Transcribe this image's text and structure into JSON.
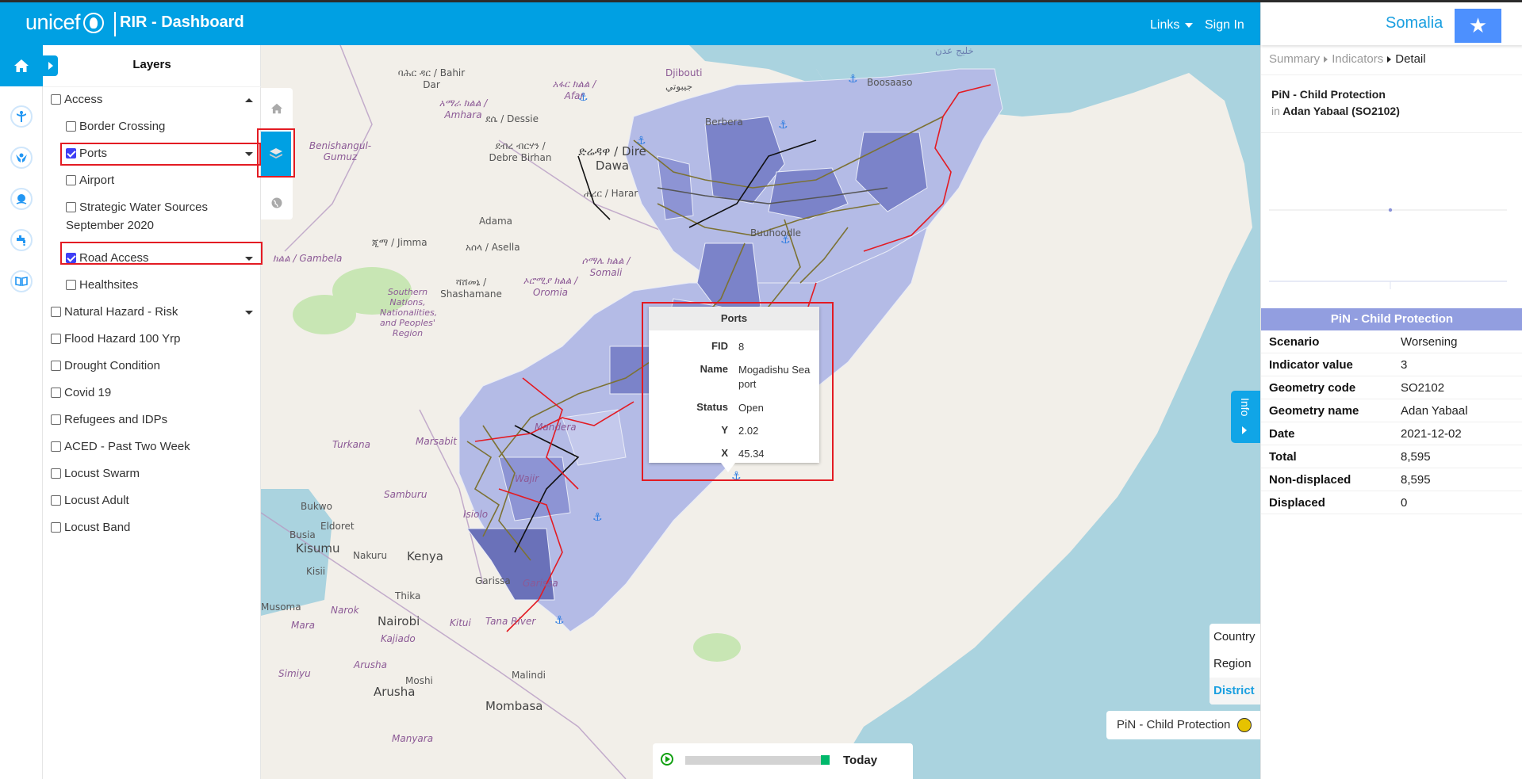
{
  "header": {
    "logo_text": "unicef",
    "app_title": "RIR - Dashboard",
    "links_label": "Links",
    "signin_label": "Sign In",
    "brand_color": "#00a0e3"
  },
  "iconbar": {
    "items": [
      {
        "name": "home",
        "icon": "home-icon"
      },
      {
        "name": "health",
        "icon": "health-icon"
      },
      {
        "name": "protection",
        "icon": "child-protection-icon"
      },
      {
        "name": "nutrition",
        "icon": "nutrition-icon"
      },
      {
        "name": "wash",
        "icon": "water-tap-icon"
      },
      {
        "name": "education",
        "icon": "book-icon"
      }
    ]
  },
  "layers_panel": {
    "title": "Layers",
    "items": [
      {
        "label": "Access",
        "checked": false,
        "level": 0,
        "expander": "up"
      },
      {
        "label": "Border Crossing",
        "checked": false,
        "level": 1
      },
      {
        "label": "Ports",
        "checked": true,
        "level": 1,
        "expander": "down",
        "highlighted": true
      },
      {
        "label": "Airport",
        "checked": false,
        "level": 1
      },
      {
        "label": "Strategic Water Sources",
        "label2": "September 2020",
        "checked": false,
        "level": 1
      },
      {
        "label": "Road Access",
        "checked": true,
        "level": 1,
        "expander": "down",
        "highlighted": true
      },
      {
        "label": "Healthsites",
        "checked": false,
        "level": 1
      },
      {
        "label": "Natural Hazard - Risk",
        "checked": false,
        "level": 0,
        "expander": "down"
      },
      {
        "label": "Flood Hazard 100 Yrp",
        "checked": false,
        "level": 0
      },
      {
        "label": "Drought Condition",
        "checked": false,
        "level": 0
      },
      {
        "label": "Covid 19",
        "checked": false,
        "level": 0
      },
      {
        "label": "Refugees and IDPs",
        "checked": false,
        "level": 0
      },
      {
        "label": "ACED - Past Two Week",
        "checked": false,
        "level": 0
      },
      {
        "label": "Locust Swarm",
        "checked": false,
        "level": 0
      },
      {
        "label": "Locust Adult",
        "checked": false,
        "level": 0
      },
      {
        "label": "Locust Band",
        "checked": false,
        "level": 0
      }
    ]
  },
  "map": {
    "controls": [
      {
        "name": "home",
        "icon": "home-icon"
      },
      {
        "name": "layers",
        "icon": "layers-icon",
        "active": true
      },
      {
        "name": "basemap",
        "icon": "globe-icon"
      }
    ],
    "labels": {
      "djibouti": "Djibouti",
      "djibouti_ar": "جيبوتي",
      "gulf_aden": "خليج عدن",
      "bahir_dar": "ባሕር ዳር / Bahir Dar",
      "amhara": "አማራ ክልል / Amhara",
      "afar": "አፋር ክልል / Afar",
      "dessie": "ደሴ / Dessie",
      "debre_birhan": "ደብረ ብርሃን / Debre Birhan",
      "dire_dawa": "ድሬዳዋ / Dire Dawa",
      "harar": "ሐረር / Harar",
      "benishangul": "Benishangul-Gumuz",
      "adama": "Adama",
      "asella": "አሰላ / Asella",
      "jimma": "ጂማ / Jimma",
      "gambela": "ክልል / Gambela",
      "shashamane": "ሻሸመኔ / Shashamane",
      "oromia": "ኦሮሚያ ክልል / Oromia",
      "snnpr": "Southern Nations, Nationalities, and Peoples' Region",
      "somali_region": "ሶማሌ ክልል / Somali",
      "berbera": "Berbera",
      "boosaaso": "Boosaaso",
      "buuhoodle": "Buuhoodle",
      "mandera": "Mandera",
      "turkana": "Turkana",
      "marsabit": "Marsabit",
      "wajir": "Wajir",
      "samburu": "Samburu",
      "isiolo": "Isiolo",
      "bukwo": "Bukwo",
      "eldoret": "Eldoret",
      "busia": "Busia",
      "kisumu": "Kisumu",
      "nakuru": "Nakuru",
      "kenya": "Kenya",
      "kisii": "Kisii",
      "garissa_town": "Garissa",
      "garissa": "Garissa",
      "thika": "Thika",
      "musoma": "Musoma",
      "narok": "Narok",
      "nairobi": "Nairobi",
      "kitui": "Kitui",
      "tana_river": "Tana River",
      "mara": "Mara",
      "kajiado": "Kajiado",
      "arusha_region": "Arusha",
      "simiyu": "Simiyu",
      "moshi": "Moshi",
      "arusha": "Arusha",
      "malindi": "Malindi",
      "mombasa": "Mombasa",
      "manyara": "Manyara"
    },
    "popup": {
      "title": "Ports",
      "fields": [
        {
          "key": "FID",
          "value": "8"
        },
        {
          "key": "Name",
          "value": "Mogadishu Sea port"
        },
        {
          "key": "Status",
          "value": "Open"
        },
        {
          "key": "Y",
          "value": "2.02"
        },
        {
          "key": "X",
          "value": "45.34"
        }
      ]
    },
    "info_tab_label": "Info",
    "admin_levels": {
      "options": [
        "Country",
        "Region",
        "District"
      ],
      "selected": "District"
    },
    "legend": {
      "label": "PiN - Child Protection",
      "color": "#e6c200"
    },
    "timeline": {
      "label": "Today",
      "progress": 1.0
    }
  },
  "right_panel": {
    "country": "Somalia",
    "breadcrumb": [
      "Summary",
      "Indicators",
      "Detail"
    ],
    "indicator_title": "PiN - Child Protection",
    "location_prefix": "in",
    "location": "Adan Yabaal (SO2102)",
    "table_title": "PiN - Child Protection",
    "rows": [
      {
        "key": "Scenario",
        "value": "Worsening"
      },
      {
        "key": "Indicator value",
        "value": "3"
      },
      {
        "key": "Geometry code",
        "value": "SO2102"
      },
      {
        "key": "Geometry name",
        "value": "Adan Yabaal"
      },
      {
        "key": "Date",
        "value": "2021-12-02"
      },
      {
        "key": "Total",
        "value": "8,595"
      },
      {
        "key": "Non-displaced",
        "value": "8,595"
      },
      {
        "key": "Displaced",
        "value": "0"
      }
    ],
    "accent_color": "#929ee0"
  }
}
